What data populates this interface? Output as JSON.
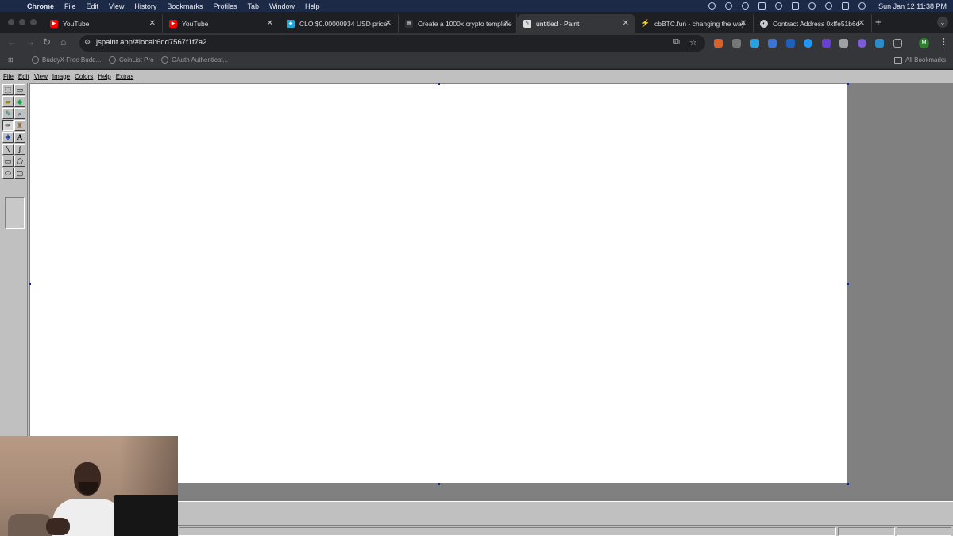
{
  "menubar": {
    "app": "Chrome",
    "items": [
      "File",
      "Edit",
      "View",
      "History",
      "Bookmarks",
      "Profiles",
      "Tab",
      "Window",
      "Help"
    ],
    "clock": "Sun Jan 12  11:38 PM"
  },
  "tabs": [
    {
      "title": "YouTube",
      "favicon": "youtube-icon",
      "color": "#ff0000"
    },
    {
      "title": "YouTube",
      "favicon": "youtube-icon",
      "color": "#ff0000"
    },
    {
      "title": "CLO $0.00000934 USD price",
      "favicon": "coin-icon",
      "color": "#27a4d8"
    },
    {
      "title": "Create a 1000x crypto template",
      "favicon": "doc-icon",
      "color": "#222222"
    },
    {
      "title": "untitled - Paint",
      "favicon": "paint-icon",
      "color": "#dddddd"
    },
    {
      "title": "cbBTC.fun - changing the way",
      "favicon": "bolt-icon",
      "color": "#1e88e5"
    },
    {
      "title": "Contract Address 0xffe51b6d",
      "favicon": "etherscan-icon",
      "color": "#cccccc"
    }
  ],
  "active_tab_index": 4,
  "address": {
    "url": "jspaint.app/#local:6dd7567f1f7a2"
  },
  "profile_initial": "M",
  "bookmarks": [
    {
      "label": "BuddyX Free Budd..."
    },
    {
      "label": "CoinList Pro"
    },
    {
      "label": "OAuth Authenticat..."
    }
  ],
  "all_bookmarks_label": "All Bookmarks",
  "paint": {
    "menus": [
      "File",
      "Edit",
      "View",
      "Image",
      "Colors",
      "Help",
      "Extras"
    ],
    "tools": [
      {
        "name": "free-form-select-tool",
        "glyph": "⬚"
      },
      {
        "name": "select-tool",
        "glyph": "▭"
      },
      {
        "name": "eraser-tool",
        "glyph": "▰"
      },
      {
        "name": "fill-with-color-tool",
        "glyph": "◆"
      },
      {
        "name": "pick-color-tool",
        "glyph": "✎"
      },
      {
        "name": "magnifier-tool",
        "glyph": "⌕"
      },
      {
        "name": "pencil-tool",
        "glyph": "✏"
      },
      {
        "name": "brush-tool",
        "glyph": "♜"
      },
      {
        "name": "airbrush-tool",
        "glyph": "✱"
      },
      {
        "name": "text-tool",
        "glyph": "A"
      },
      {
        "name": "line-tool",
        "glyph": "╲"
      },
      {
        "name": "curve-tool",
        "glyph": "∫"
      },
      {
        "name": "rectangle-tool",
        "glyph": "▭"
      },
      {
        "name": "polygon-tool",
        "glyph": "⬠"
      },
      {
        "name": "ellipse-tool",
        "glyph": "⬭"
      },
      {
        "name": "rounded-rectangle-tool",
        "glyph": "▢"
      }
    ],
    "selected_tool": "pencil-tool"
  }
}
